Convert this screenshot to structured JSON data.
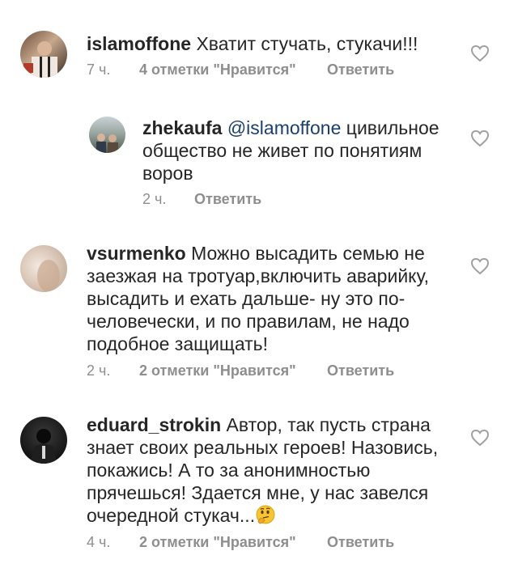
{
  "comments": [
    {
      "username": "islamoffone",
      "text": "Хватит стучать, стукачи!!!",
      "time": "7 ч.",
      "likes": "4 отметки \"Нравится\"",
      "reply": "Ответить"
    },
    {
      "username": "zhekaufa",
      "mention": "@islamoffone",
      "text": "цивильное общество не живет по понятиям воров",
      "time": "2 ч.",
      "reply": "Ответить"
    },
    {
      "username": "vsurmenko",
      "text": "Можно высадить семью не заезжая на тротуар,включить аварийку, высадить и ехать дальше- ну это по-человечески, и по правилам, не надо подобное защищать!",
      "time": "2 ч.",
      "likes": "2 отметки \"Нравится\"",
      "reply": "Ответить"
    },
    {
      "username": "eduard_strokin",
      "text": "Автор, так пусть страна знает своих реальных героев! Назовись, покажись! А то за анонимностью прячешься! Здается мне, у нас завелся очередной стукач...",
      "time": "4 ч.",
      "likes": "2 отметки \"Нравится\"",
      "reply": "Ответить"
    }
  ],
  "icons": {
    "like": "heart-outline-icon",
    "emoji": "thinking-face-emoji"
  },
  "colors": {
    "text": "#262626",
    "meta": "#8e8e8e",
    "mention": "#1b3f6e",
    "heart": "#a0a0a0"
  }
}
